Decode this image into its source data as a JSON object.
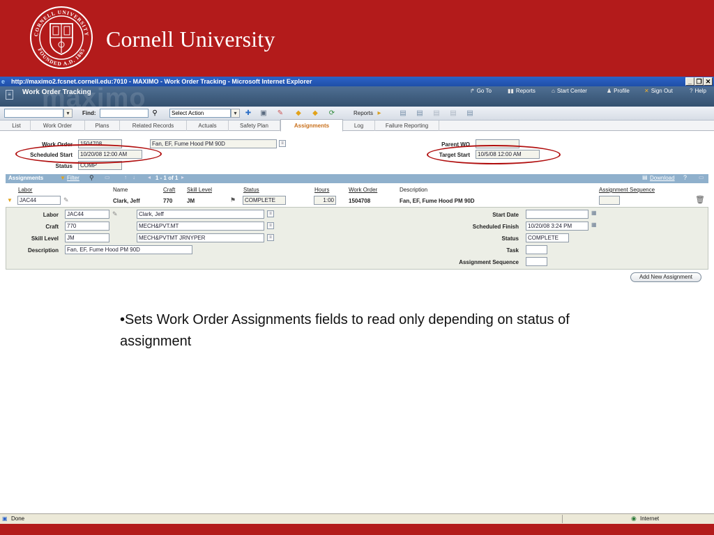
{
  "banner": {
    "university_name": "Cornell University",
    "seal_text_top": "CORNELL UNIVERSITY",
    "seal_text_bottom": "FOUNDED A.D. 1865",
    "color": "#b31b1b"
  },
  "browser": {
    "window_title": "http://maximo2.fcsnet.cornell.edu:7010 - MAXIMO - Work Order Tracking - Microsoft Internet Explorer",
    "minimize": "_",
    "restore": "❐",
    "close": "✕",
    "status_text": "Done",
    "zone": "Internet"
  },
  "app": {
    "watermark": "maximo",
    "title": "Work Order Tracking",
    "nav": {
      "goto": "Go To",
      "reports": "Reports",
      "start_center": "Start Center",
      "profile": "Profile",
      "sign_out": "Sign Out",
      "help": "Help"
    }
  },
  "toolbar": {
    "find_label": "Find:",
    "action_select": "Select Action",
    "reports_label": "Reports"
  },
  "tabs": [
    {
      "label": "List"
    },
    {
      "label": "Work Order"
    },
    {
      "label": "Plans"
    },
    {
      "label": "Related Records"
    },
    {
      "label": "Actuals"
    },
    {
      "label": "Safety Plan"
    },
    {
      "label": "Assignments"
    },
    {
      "label": "Log"
    },
    {
      "label": "Failure Reporting"
    }
  ],
  "header_fields": {
    "work_order_label": "Work Order",
    "work_order_value": "1504708",
    "description_value": "Fan, EF, Fume Hood PM 90D",
    "scheduled_start_label": "Scheduled Start",
    "scheduled_start_value": "10/20/08 12:00 AM",
    "status_label": "Status",
    "status_value": "COMP",
    "parent_wo_label": "Parent WO",
    "parent_wo_value": "",
    "target_start_label": "Target Start",
    "target_start_value": "10/5/08 12:00 AM"
  },
  "assignments": {
    "section_title": "Assignments",
    "filter": "Filter",
    "pager": "1 - 1 of 1",
    "download": "Download",
    "columns": {
      "labor": "Labor",
      "name": "Name",
      "craft": "Craft",
      "skill_level": "Skill Level",
      "status": "Status",
      "hours": "Hours",
      "work_order": "Work Order",
      "description": "Description",
      "assignment_sequence": "Assignment Sequence"
    },
    "row": {
      "labor": "JAC44",
      "name": "Clark, Jeff",
      "craft": "770",
      "skill_level": "JM",
      "status": "COMPLETE",
      "hours": "1:00",
      "work_order": "1504708",
      "description": "Fan, EF, Fume Hood PM 90D",
      "assignment_sequence": ""
    },
    "detail": {
      "labor_label": "Labor",
      "labor_value": "JAC44",
      "labor_name": "Clark, Jeff",
      "craft_label": "Craft",
      "craft_value": "770",
      "craft_desc": "MECH&PVT.MT",
      "skill_label": "Skill Level",
      "skill_value": "JM",
      "skill_desc": "MECH&PVTMT JRNYPER",
      "description_label": "Description",
      "description_value": "Fan, EF, Fume Hood PM 90D",
      "start_date_label": "Start Date",
      "start_date_value": "",
      "scheduled_finish_label": "Scheduled Finish",
      "scheduled_finish_value": "10/20/08 3:24 PM",
      "status_label": "Status",
      "status_value": "COMPLETE",
      "task_label": "Task",
      "task_value": "",
      "assignment_sequence_label": "Assignment Sequence",
      "assignment_sequence_value": ""
    },
    "add_button": "Add New Assignment"
  },
  "caption": "•Sets Work Order Assignments fields to read only depending on status of assignment"
}
